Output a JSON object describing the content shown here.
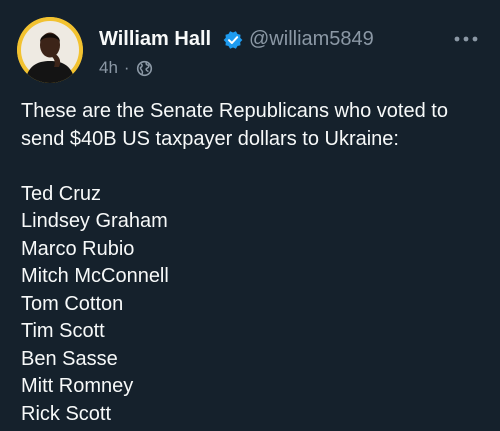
{
  "author": {
    "name": "William Hall",
    "handle": "@william5849",
    "time": "4h",
    "separator": "·",
    "visibility_icon": "globe-icon",
    "verified_icon": "verified-badge-icon",
    "avatar_ring_color": "#f2c230",
    "verified_color": "#1d9bf0"
  },
  "more_icon": "more-options-icon",
  "tweet": {
    "text": "These are the Senate Republicans who voted to send $40B US taxpayer dollars to Ukraine:",
    "names": [
      "Ted Cruz",
      "Lindsey Graham",
      "Marco Rubio",
      "Mitch McConnell",
      "Tom Cotton",
      "Tim Scott",
      "Ben Sasse",
      "Mitt Romney",
      "Rick Scott"
    ]
  },
  "theme": {
    "background": "#15212c",
    "text": "#f7f9f9",
    "secondary_text": "#8b98a5"
  }
}
